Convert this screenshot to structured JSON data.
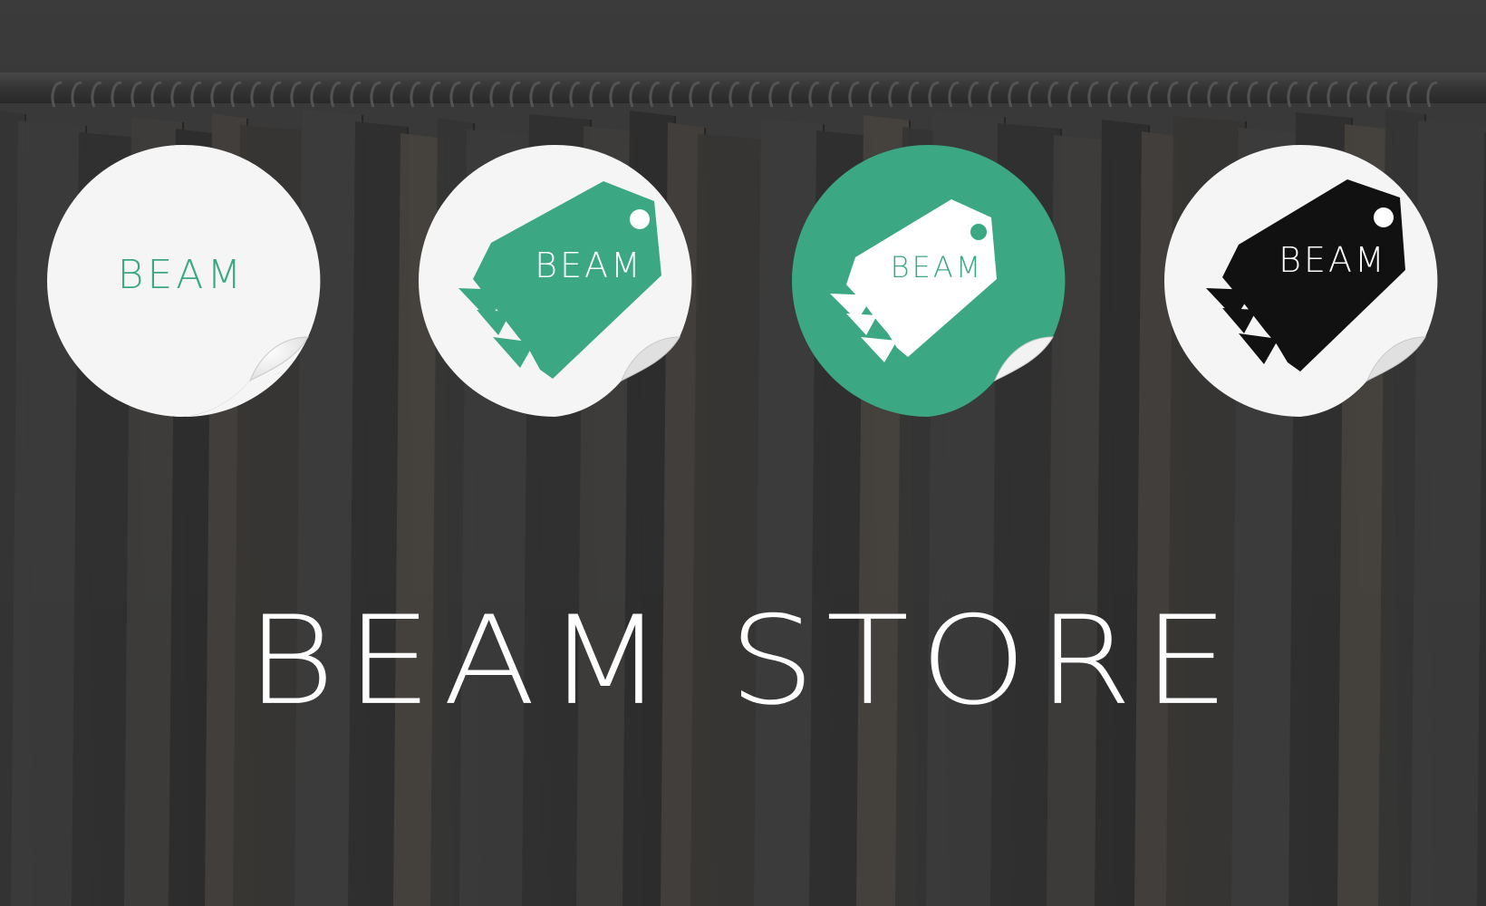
{
  "stickers": [
    {
      "variant": "text-only",
      "wordmark": "BEAM",
      "background": "#ffffff",
      "text_color": "#3ba883"
    },
    {
      "variant": "tag-on-white",
      "wordmark": "BEAM",
      "background": "#ffffff",
      "tag_color": "#3ba883",
      "text_color": "#ffffff",
      "icon": "price-tag-icon"
    },
    {
      "variant": "tag-on-green",
      "wordmark": "BEAM",
      "background": "#3ba883",
      "tag_color": "#ffffff",
      "text_color": "#3ba883",
      "icon": "price-tag-icon"
    },
    {
      "variant": "black-tag-on-white",
      "wordmark": "BEAM",
      "background": "#ffffff",
      "tag_color": "#111111",
      "text_color": "#ffffff",
      "icon": "price-tag-icon"
    }
  ],
  "headline": "BEAM STORE",
  "colors": {
    "brand_green": "#3ba883",
    "background": "#3a3a3a",
    "headline": "#ffffff"
  },
  "background_image": "clothing-rack-photo"
}
